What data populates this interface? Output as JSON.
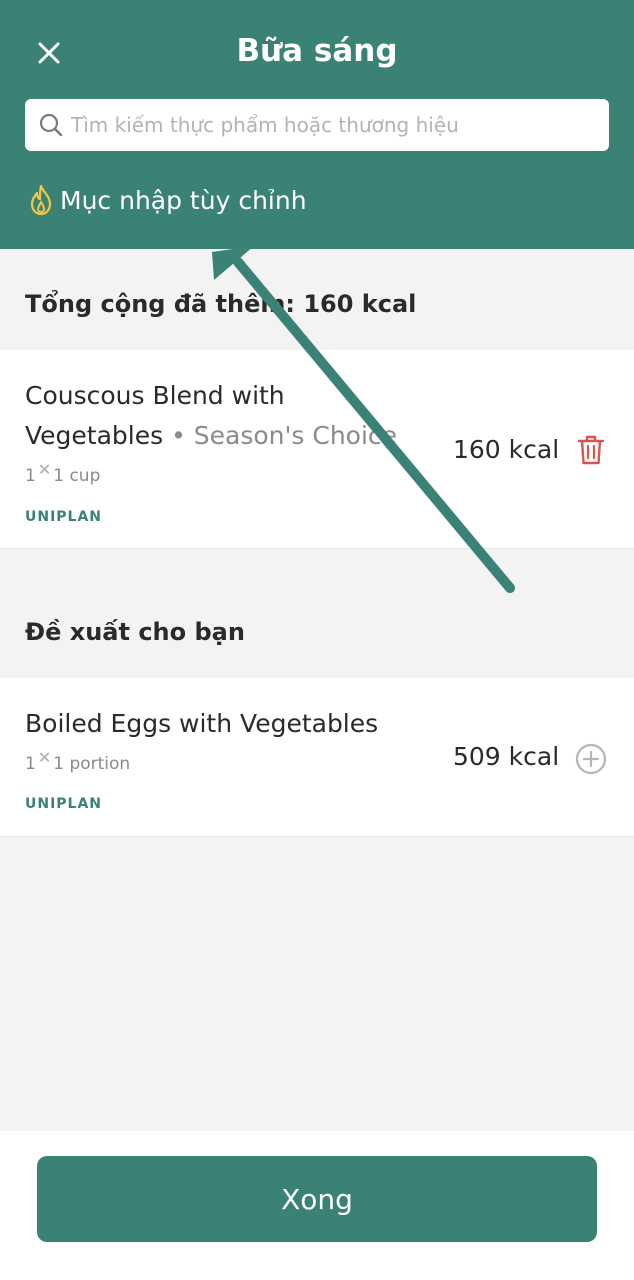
{
  "header": {
    "title": "Bữa sáng",
    "search_placeholder": "Tìm kiếm thực phẩm hoặc thương hiệu",
    "custom_entry_label": "Mục nhập tùy chỉnh"
  },
  "added": {
    "section_title": "Tổng cộng đã thêm: 160 kcal",
    "items": [
      {
        "name_line1": "Couscous Blend with",
        "name_line2": "Vegetables",
        "brand": "Season's Choice",
        "qty": "1",
        "unit": "1 cup",
        "tag": "UNIPLAN",
        "kcal": "160 kcal"
      }
    ]
  },
  "suggested": {
    "section_title": "Đề xuất cho bạn",
    "items": [
      {
        "name": "Boiled Eggs with Vegetables",
        "qty": "1",
        "unit": "1 portion",
        "tag": "UNIPLAN",
        "kcal": "509 kcal"
      }
    ]
  },
  "footer": {
    "done_label": "Xong"
  },
  "colors": {
    "primary": "#3a8275",
    "delete": "#d9534f",
    "flame": "#f2c744"
  },
  "icons": [
    "close-icon",
    "search-icon",
    "flame-icon",
    "trash-icon",
    "plus-circle-icon"
  ]
}
